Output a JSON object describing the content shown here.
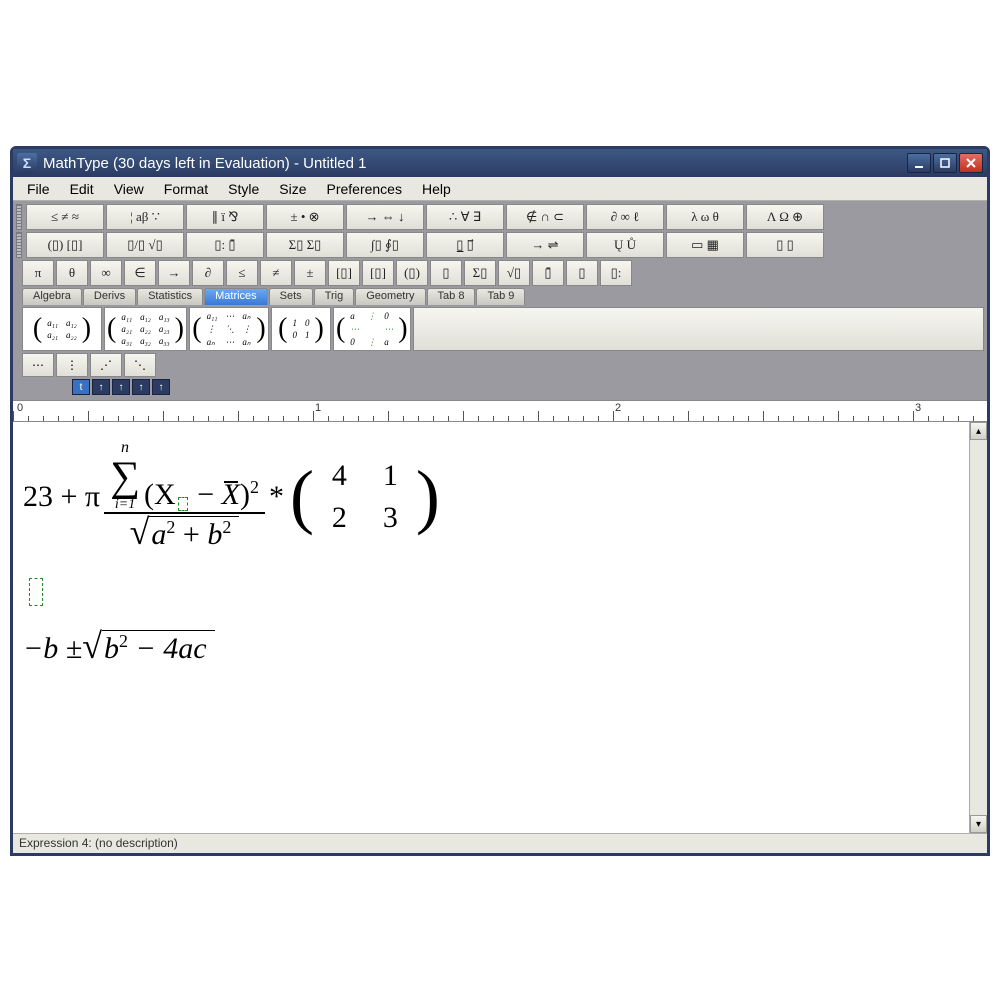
{
  "window": {
    "title": "MathType (30 days left in Evaluation) - Untitled 1",
    "app_icon_glyph": "Σ"
  },
  "menubar": [
    "File",
    "Edit",
    "View",
    "Format",
    "Style",
    "Size",
    "Preferences",
    "Help"
  ],
  "symbol_toolbar_row1": [
    "≤ ≠ ≈",
    "¦ aβ ∵",
    "∥ ï ⅋",
    "± • ⊗",
    "→ ⇔ ↓",
    "∴ ∀ ∃",
    "∉ ∩ ⊂",
    "∂ ∞ ℓ",
    "λ ω θ",
    "Λ Ω ⊕"
  ],
  "symbol_toolbar_row2": [
    "(▯) [▯]",
    "▯/▯ √▯",
    "▯: ▯̄",
    "Σ▯ Σ▯",
    "∫▯ ∮▯",
    "▯̲ ▯⃗",
    "→ ⇌",
    "Ų Ů",
    "▭ ▦",
    "▯ ▯"
  ],
  "quick_symbols": [
    "π",
    "θ",
    "∞",
    "∈",
    "→",
    "∂",
    "≤",
    "≠",
    "±",
    "[▯]",
    "[▯]",
    "(▯)",
    "▯",
    "Σ▯",
    "√▯",
    "▯̄",
    "▯",
    "▯:"
  ],
  "tabs": [
    "Algebra",
    "Derivs",
    "Statistics",
    "Matrices",
    "Sets",
    "Trig",
    "Geometry",
    "Tab 8",
    "Tab 9"
  ],
  "active_tab": "Matrices",
  "matrix_templates": [
    "(a₁₁ a₁₂; a₂₁ a₂₂)",
    "(a₁₁ a₁₂ a₁₃; a₂₁ a₂₂ a₂₃; a₃₁ a₃₂ a₃₃)",
    "(a₁₁ ⋯ aₙ; ⋮ ⋱ ⋮; aₙ ⋯ aₙ)",
    "(1 0; 0 1)",
    "(a ⋮ 0; ⋯ ⋯; 0 ⋮ a)"
  ],
  "dot_buttons": [
    "⋯",
    "⋮",
    "⋰",
    "⋱"
  ],
  "ruler_markers": [
    "0",
    "1",
    "2",
    "3"
  ],
  "equations": {
    "eq1": {
      "lead": "23 + π",
      "sum_upper": "n",
      "sum_lower": "i=1",
      "sum_body_pre": "(X",
      "sum_body_mid": " − ",
      "sum_body_var": "X",
      "sum_body_post": ")",
      "sum_exp": "2",
      "denom_a": "a",
      "denom_plus": " + ",
      "denom_b": "b",
      "denom_exp": "2",
      "times": " * ",
      "matrix": [
        [
          "4",
          "1"
        ],
        [
          "2",
          "3"
        ]
      ]
    },
    "eq2": {
      "pre": "−b ± ",
      "rad_b": "b",
      "rad_exp": "2",
      "rad_rest": " − 4ac"
    }
  },
  "statusbar": "Expression 4: (no description)"
}
